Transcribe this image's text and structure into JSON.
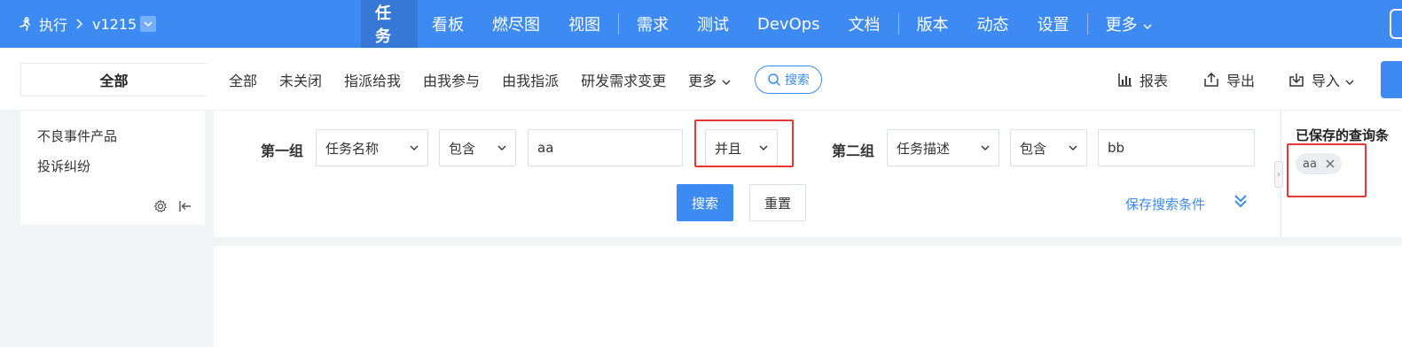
{
  "topbar": {
    "module": "执行",
    "version": "v1215",
    "nav": [
      {
        "label": "任务",
        "active": true
      },
      {
        "label": "看板"
      },
      {
        "label": "燃尽图"
      },
      {
        "label": "视图"
      },
      {
        "label": "需求"
      },
      {
        "label": "测试"
      },
      {
        "label": "DevOps"
      },
      {
        "label": "文档"
      },
      {
        "label": "版本"
      },
      {
        "label": "动态"
      },
      {
        "label": "设置"
      },
      {
        "label": "更多"
      }
    ]
  },
  "subbar": {
    "scope": "全部",
    "filters": [
      "全部",
      "未关闭",
      "指派给我",
      "由我参与",
      "由我指派",
      "研发需求变更",
      "更多"
    ],
    "search_label": "搜索",
    "report_label": "报表",
    "export_label": "导出",
    "import_label": "导入"
  },
  "leftpanel": {
    "items": [
      "不良事件产品",
      "投诉纠纷"
    ]
  },
  "search": {
    "group1": {
      "label": "第一组",
      "field": "任务名称",
      "op": "包含",
      "value": "aa"
    },
    "logic": "并且",
    "group2": {
      "label": "第二组",
      "field": "任务描述",
      "op": "包含",
      "value": "bb"
    },
    "search_btn": "搜索",
    "reset_btn": "重置",
    "save_link": "保存搜索条件"
  },
  "saved": {
    "title": "已保存的查询条",
    "tags": [
      "aa"
    ]
  },
  "colors": {
    "primary": "#3d8bf2",
    "highlight": "#e53935"
  }
}
